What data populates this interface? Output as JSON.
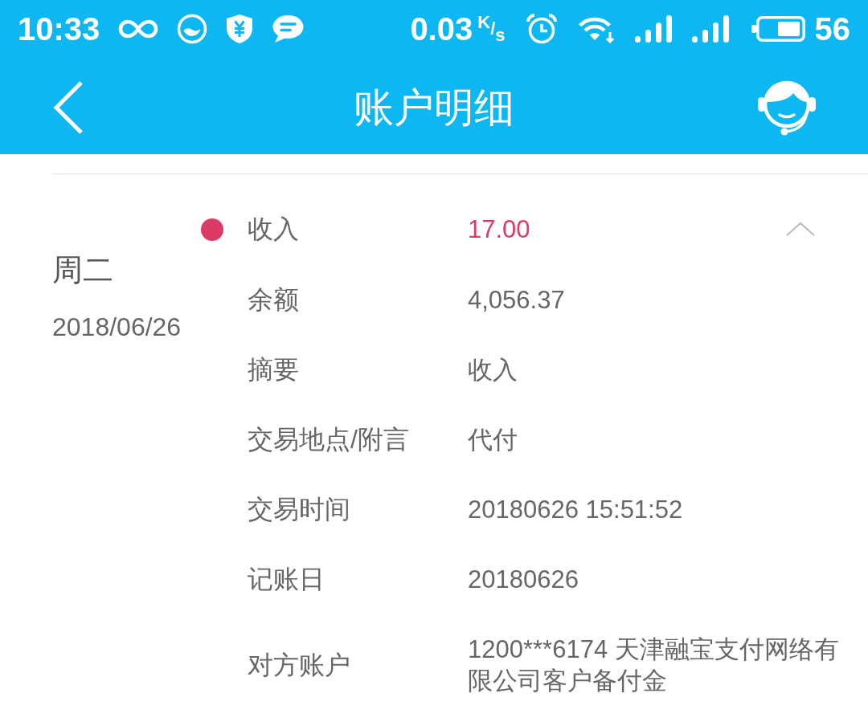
{
  "status_bar": {
    "time": "10:33",
    "net_speed": "0.03",
    "net_speed_unit": "$^{K}$/$_{s}$",
    "battery": "56"
  },
  "header": {
    "title": "账户明细"
  },
  "transactions": [
    {
      "weekday": "周二",
      "date": "2018/06/26",
      "color": "#dc3a67",
      "type": "收入",
      "amount": "17.00",
      "expanded": true,
      "details": [
        {
          "label": "余额",
          "value": "4,056.37"
        },
        {
          "label": "摘要",
          "value": "收入"
        },
        {
          "label": "交易地点/附言",
          "value": "代付"
        },
        {
          "label": "交易时间",
          "value": "20180626 15:51:52"
        },
        {
          "label": "记账日",
          "value": "20180626"
        },
        {
          "label": "对方账户",
          "value": "1200***6174 天津融宝支付网络有限公司客户备付金"
        }
      ]
    }
  ]
}
